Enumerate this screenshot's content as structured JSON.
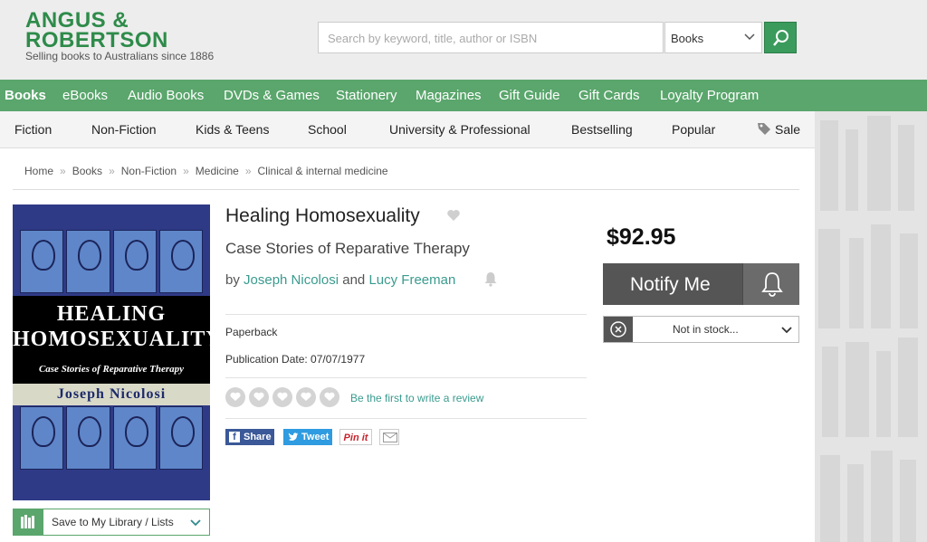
{
  "header": {
    "logo_line1": "ANGUS &",
    "logo_line2": "ROBERTSON",
    "tagline": "Selling books to Australians since 1886",
    "search_placeholder": "Search by keyword, title, author or ISBN",
    "search_category": "Books"
  },
  "nav": {
    "items": [
      "Books",
      "eBooks",
      "Audio Books",
      "DVDs & Games",
      "Stationery",
      "Magazines",
      "Gift Guide",
      "Gift Cards",
      "Loyalty Program"
    ]
  },
  "subnav": {
    "items": [
      "Fiction",
      "Non-Fiction",
      "Kids & Teens",
      "School",
      "University & Professional",
      "Bestselling",
      "Popular",
      "Sale"
    ]
  },
  "breadcrumb": [
    "Home",
    "Books",
    "Non-Fiction",
    "Medicine",
    "Clinical & internal medicine"
  ],
  "cover": {
    "title_line1": "HEALING",
    "title_line2": "HOMOSEXUALITY",
    "subtitle": "Case Stories of Reparative Therapy",
    "author": "Joseph Nicolosi"
  },
  "product": {
    "title": "Healing Homosexuality",
    "subtitle": "Case Stories of Reparative Therapy",
    "by": "by",
    "and": "and",
    "author1": "Joseph Nicolosi",
    "author2": "Lucy Freeman",
    "format": "Paperback",
    "publication_date": "Publication Date: 07/07/1977",
    "review_link": "Be the first to write a review",
    "rating": 0,
    "rating_max": 5
  },
  "social": {
    "facebook": "Share",
    "twitter": "Tweet",
    "pinterest": "Pin it"
  },
  "purchase": {
    "price": "$92.95",
    "notify_label": "Notify Me",
    "stock_label": "Not in stock..."
  },
  "library": {
    "save_label": "Save to My Library / Lists"
  },
  "colors": {
    "brand_green": "#2e8b4a",
    "nav_green": "#5aa66c",
    "link_teal": "#3a9b8f"
  }
}
